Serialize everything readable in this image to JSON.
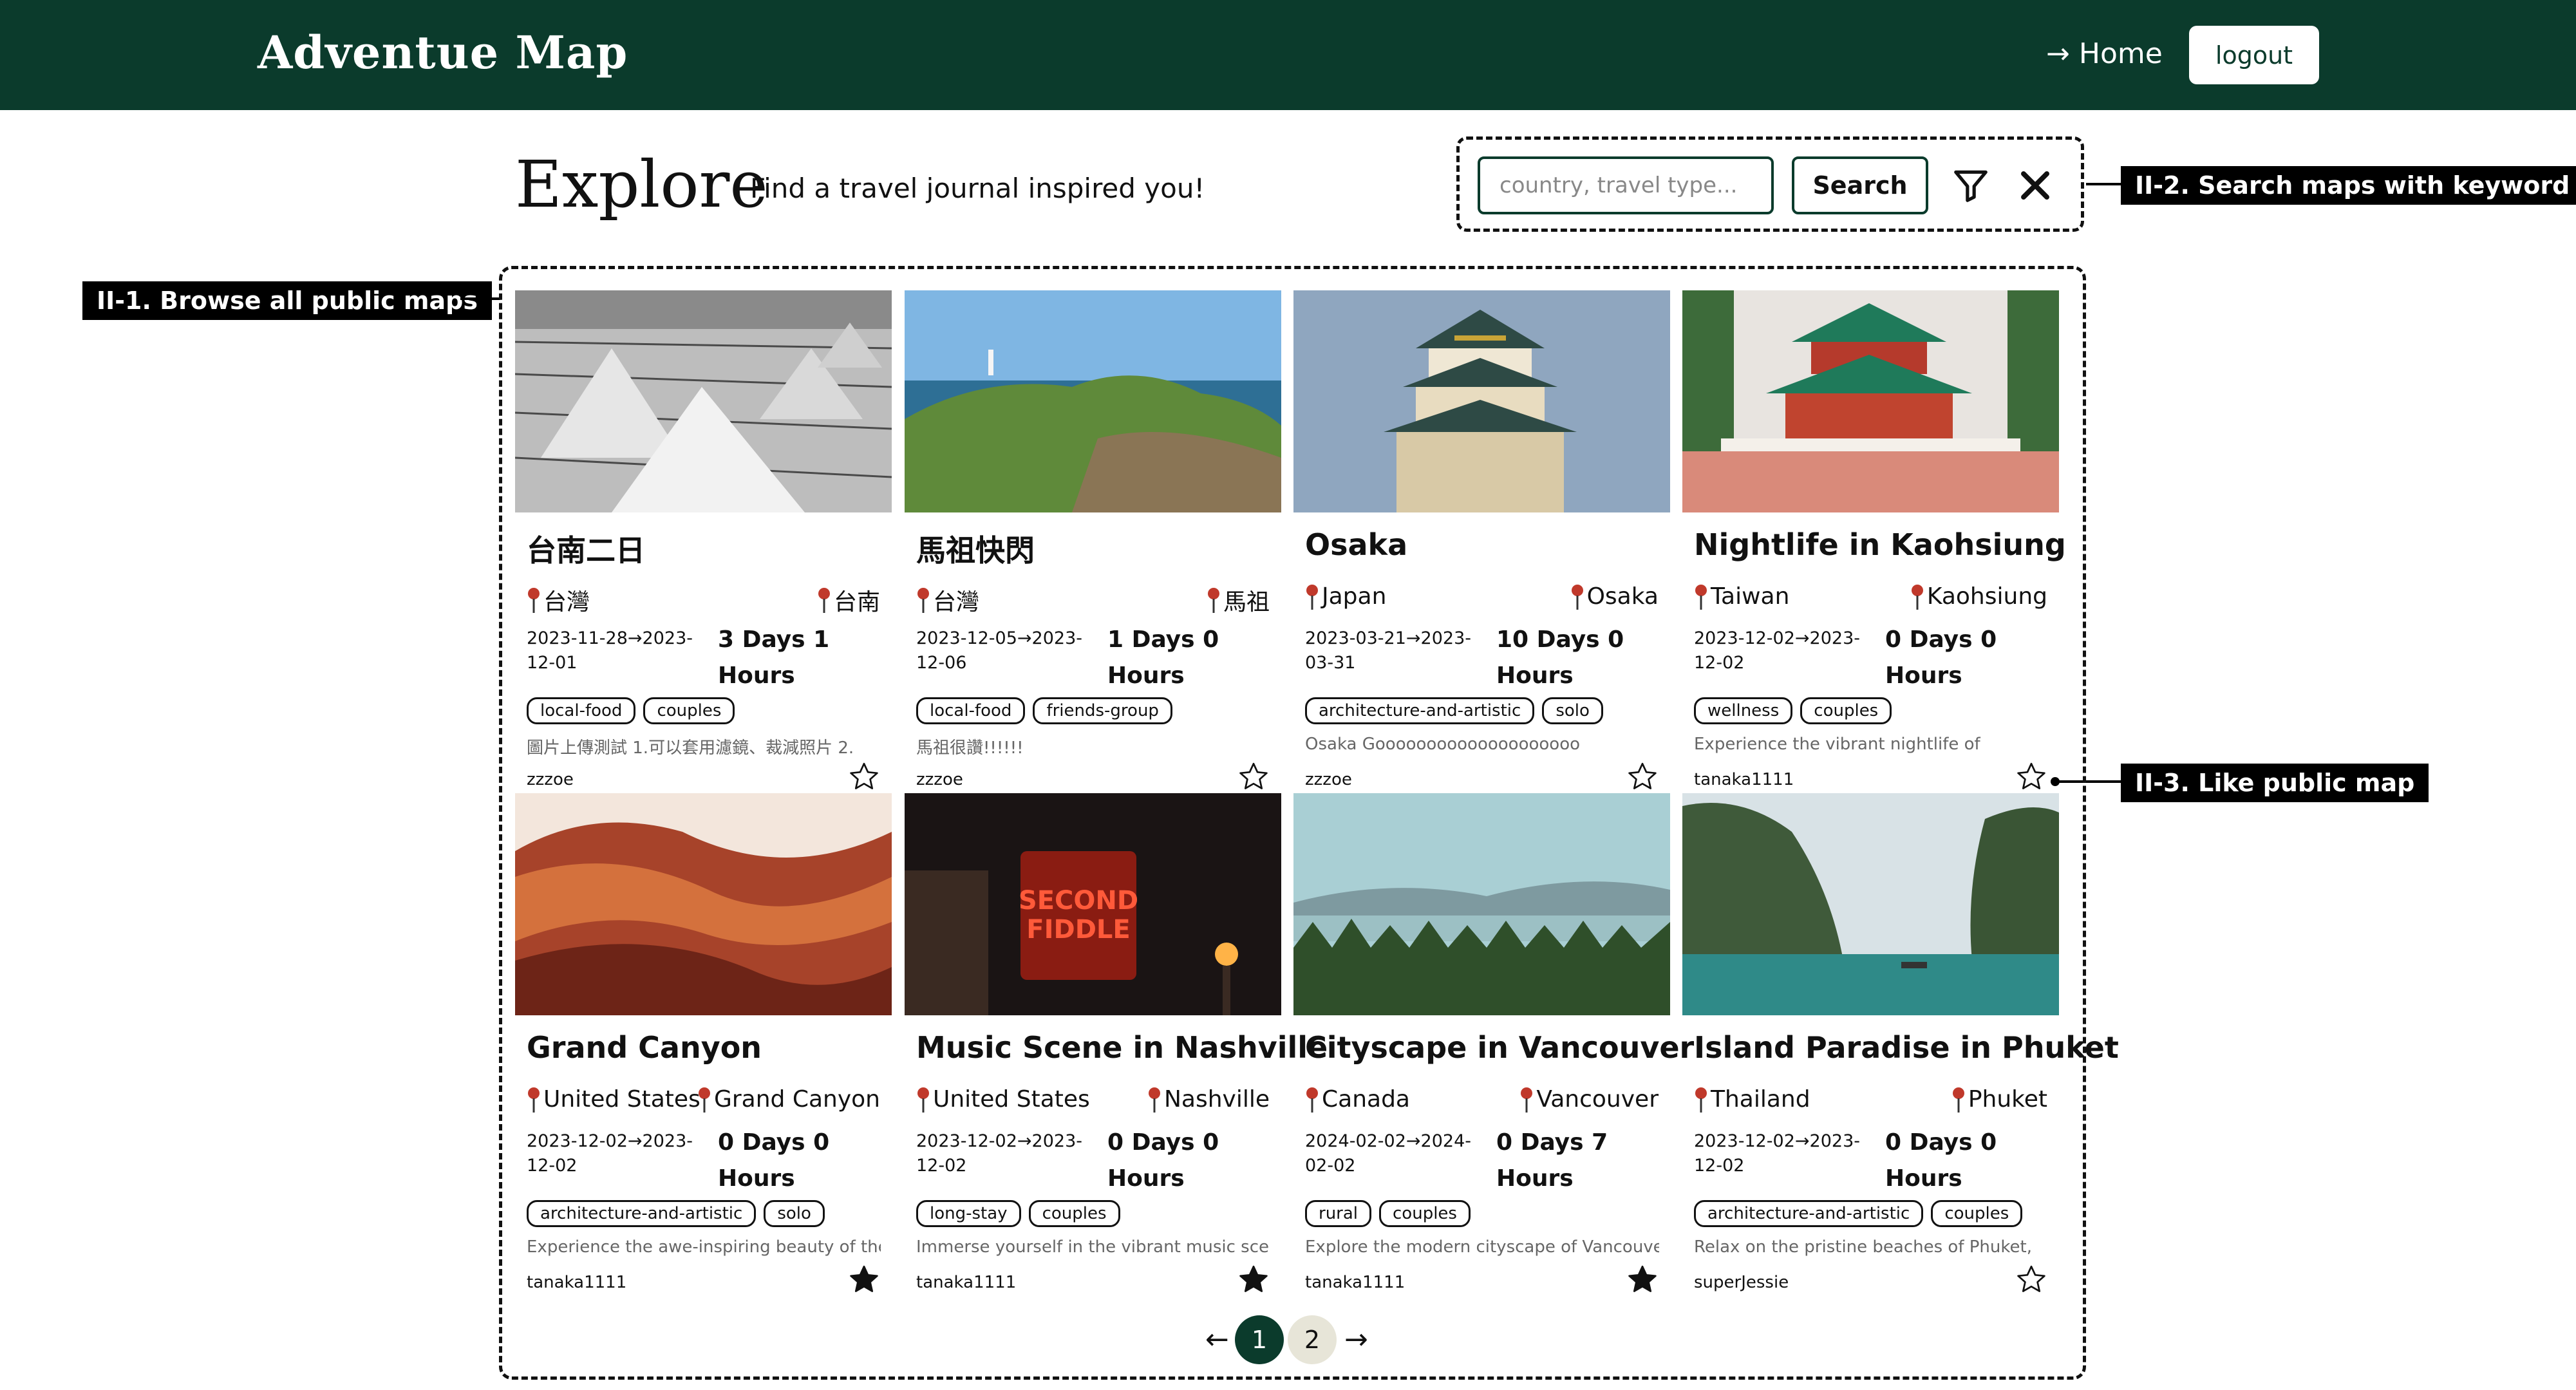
{
  "header": {
    "brand": "Adventue Map",
    "home_link": "→ Home",
    "logout_label": "logout"
  },
  "explore": {
    "title": "Explore",
    "subtitle": "Find a travel journal inspired you!"
  },
  "search": {
    "placeholder": "country, travel type...",
    "button_label": "Search"
  },
  "annotations": {
    "browse": "II-1. Browse all public maps",
    "search": "II-2. Search maps with keyword",
    "like": "II-3. Like public map"
  },
  "cards": [
    {
      "title": "台南二日",
      "country": "台灣",
      "city": "台南",
      "dates": "2023-11-28→2023-12-01",
      "duration": "3 Days 1 Hours",
      "tags": [
        "local-food",
        "couples"
      ],
      "desc": "圖片上傳測試 1.可以套用濾鏡、裁減照片 2.",
      "author": "zzzoe",
      "liked": false,
      "image": "salt-mounds"
    },
    {
      "title": "馬祖快閃",
      "country": "台灣",
      "city": "馬祖",
      "dates": "2023-12-05→2023-12-06",
      "duration": "1 Days 0 Hours",
      "tags": [
        "local-food",
        "friends-group"
      ],
      "desc": "馬祖很讚!!!!!!",
      "author": "zzzoe",
      "liked": false,
      "image": "green-coast"
    },
    {
      "title": "Osaka",
      "country": "Japan",
      "city": "Osaka",
      "dates": "2023-03-21→2023-03-31",
      "duration": "10 Days 0 Hours",
      "tags": [
        "architecture-and-artistic",
        "solo"
      ],
      "desc": "Osaka Goooooooooooooooooooo",
      "author": "zzzoe",
      "liked": false,
      "image": "osaka-castle"
    },
    {
      "title": "Nightlife in Kaohsiung",
      "country": "Taiwan",
      "city": "Kaohsiung",
      "dates": "2023-12-02→2023-12-02",
      "duration": "0 Days 0 Hours",
      "tags": [
        "wellness",
        "couples"
      ],
      "desc": "Experience the vibrant nightlife of",
      "author": "tanaka1111",
      "liked": false,
      "image": "pagoda"
    },
    {
      "title": "Grand Canyon",
      "country": "United States",
      "city": "Grand Canyon",
      "dates": "2023-12-02→2023-12-02",
      "duration": "0 Days 0 Hours",
      "tags": [
        "architecture-and-artistic",
        "solo"
      ],
      "desc": "Experience the awe-inspiring beauty of the",
      "author": "tanaka1111",
      "liked": true,
      "image": "canyon"
    },
    {
      "title": "Music Scene in Nashville",
      "country": "United States",
      "city": "Nashville",
      "dates": "2023-12-02→2023-12-02",
      "duration": "0 Days 0 Hours",
      "tags": [
        "long-stay",
        "couples"
      ],
      "desc": "Immerse yourself in the vibrant music scene",
      "author": "tanaka1111",
      "liked": true,
      "image": "neon"
    },
    {
      "title": "Cityscape in Vancouver",
      "country": "Canada",
      "city": "Vancouver",
      "dates": "2024-02-02→2024-02-02",
      "duration": "0 Days 7 Hours",
      "tags": [
        "rural",
        "couples"
      ],
      "desc": "Explore the modern cityscape of Vancouver,",
      "author": "tanaka1111",
      "liked": true,
      "image": "forest-lake"
    },
    {
      "title": "Island Paradise in Phuket",
      "country": "Thailand",
      "city": "Phuket",
      "dates": "2023-12-02→2023-12-02",
      "duration": "0 Days 0 Hours",
      "tags": [
        "architecture-and-artistic",
        "couples"
      ],
      "desc": "Relax on the pristine beaches of Phuket,",
      "author": "superJessie",
      "liked": false,
      "image": "island-cliffs"
    }
  ],
  "pagination": {
    "prev": "←",
    "pages": [
      "1",
      "2"
    ],
    "current": "1",
    "next": "→"
  },
  "colors": {
    "brand_dark_green": "#0b3b2c",
    "pin_red": "#c0392b",
    "page_inactive": "#e7e5d8"
  }
}
